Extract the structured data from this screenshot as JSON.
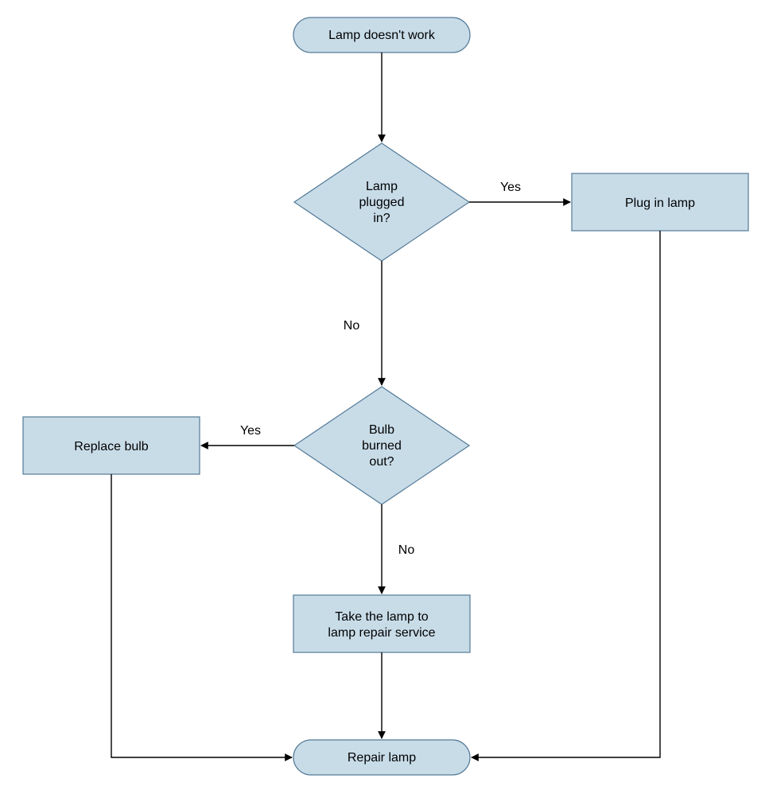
{
  "chart_data": {
    "type": "flowchart",
    "nodes": [
      {
        "id": "start",
        "shape": "terminator",
        "label": "Lamp doesn't work"
      },
      {
        "id": "plugged",
        "shape": "decision",
        "label": "Lamp plugged in?"
      },
      {
        "id": "plugin",
        "shape": "process",
        "label": "Plug in lamp"
      },
      {
        "id": "burned",
        "shape": "decision",
        "label": "Bulb burned out?"
      },
      {
        "id": "replace",
        "shape": "process",
        "label": "Replace bulb"
      },
      {
        "id": "service",
        "shape": "process",
        "label": "Take the lamp to lamp repair service"
      },
      {
        "id": "end",
        "shape": "terminator",
        "label": "Repair lamp"
      }
    ],
    "edges": [
      {
        "from": "start",
        "to": "plugged",
        "label": ""
      },
      {
        "from": "plugged",
        "to": "plugin",
        "label": "Yes"
      },
      {
        "from": "plugged",
        "to": "burned",
        "label": "No"
      },
      {
        "from": "burned",
        "to": "replace",
        "label": "Yes"
      },
      {
        "from": "burned",
        "to": "service",
        "label": "No"
      },
      {
        "from": "service",
        "to": "end",
        "label": ""
      },
      {
        "from": "replace",
        "to": "end",
        "label": ""
      },
      {
        "from": "plugin",
        "to": "end",
        "label": ""
      }
    ]
  },
  "nodes": {
    "start": {
      "label": "Lamp doesn't work"
    },
    "plugged": {
      "line1": "Lamp",
      "line2": "plugged",
      "line3": "in?"
    },
    "plugin": {
      "label": "Plug in lamp"
    },
    "burned": {
      "line1": "Bulb",
      "line2": "burned",
      "line3": "out?"
    },
    "replace": {
      "label": "Replace bulb"
    },
    "service": {
      "line1": "Take the lamp to",
      "line2": "lamp repair service"
    },
    "end": {
      "label": "Repair lamp"
    }
  },
  "edge_labels": {
    "plugged_yes": "Yes",
    "plugged_no": "No",
    "burned_yes": "Yes",
    "burned_no": "No"
  }
}
